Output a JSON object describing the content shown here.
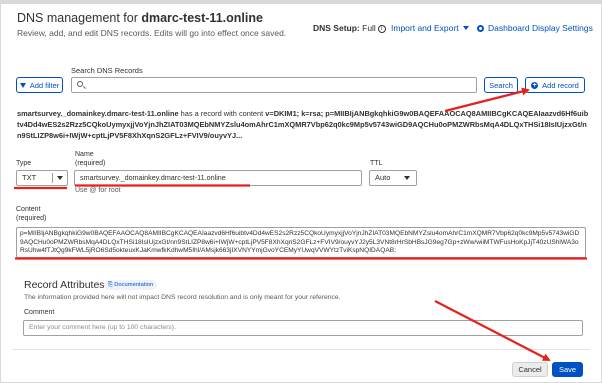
{
  "header": {
    "title_prefix": "DNS management for ",
    "domain": "dmarc-test-11.online",
    "subtitle": "Review, add, and edit DNS records. Edits will go into effect once saved.",
    "dns_setup_label": "DNS Setup:",
    "dns_setup_value": "Full",
    "import_export": "Import and Export",
    "dashboard_settings": "Dashboard Display Settings"
  },
  "toolbar": {
    "add_filter": "Add filter",
    "search_label": "Search DNS Records",
    "search_placeholder": "",
    "search_button": "Search",
    "add_record": "Add record"
  },
  "record_summary": {
    "name": "smartsurvey._domainkey.dmarc-test-11.online",
    "middle_text": " has a record with content ",
    "content": "v=DKIM1; k=rsa; p=MIIBIjANBgkqhkiG9w0BAQEFAAOCAQ8AMIIBCgKCAQEAIaazvd6Hf6uibtv4Dd4wES2s2Rzz5CQkoUymyxjjVoYjnJhZIAT03MQEbNMYZslu4omAhrC1mXQMR7Vbp62q0kc9Mp5v5743wiGD9AQCHu0oPMZWRbsMqA4DLQxTHSi18IsIUjzxGt/nn9StLIZP8w6i+IWjW+cptLjPV5F8XhXqnS2GFLz+FVIV9/ouyvYJ..."
  },
  "form": {
    "type_label": "Type",
    "type_value": "TXT",
    "name_label": "Name",
    "name_required": "(required)",
    "name_value": "smartsurvey._domainkey.dmarc-test-11.online",
    "name_hint": "Use @ for root",
    "ttl_label": "TTL",
    "ttl_value": "Auto",
    "content_label": "Content",
    "content_required": "(required)",
    "content_value": "p=MIIBIjANBgkqhkiG9w0BAQEFAAOCAQ8AMIIBCgKCAQEAIaazvd6Hf6uibtv4Dd4wES2s2Rzz5CQkoUymyxjjVoYjnJhZIAT03MQEbNMYZslu4omAhrC1mXQMR7Vbp62q0kc9Mp5v5743wiGD9AQCHu0oPMZWRbsMqA4DLQxTHSi18IsIUjzxGt/nn9StLIZP8w6i+IWjW+cptLjPV5F8XhXqnS2GFLz+FVIV9/ouyvYJ2y5L3VNt8rHrSbHBsJG9eg7Gp+zWw/wiiMTWFusHoKpJjT40zUShlWA3oRsUhw4fTJtQg9kFWL5jRO6Sd5okteuxKJaKmwfkKdhwM5Ihl/AMsjk663jIXVNYYmjGvoYCEMyYUwqVVWYtzTviKspNQIDAQAB;"
  },
  "attributes": {
    "title": "Record Attributes",
    "doc_badge": "Documentation",
    "description": "The information provided here will not impact DNS record resolution and is only meant for your reference.",
    "comment_label": "Comment",
    "comment_placeholder": "Enter your comment here (up to 100 characters)."
  },
  "footer": {
    "cancel": "Cancel",
    "save": "Save"
  },
  "colors": {
    "accent": "#0051c3",
    "annotation": "#e8201c"
  }
}
